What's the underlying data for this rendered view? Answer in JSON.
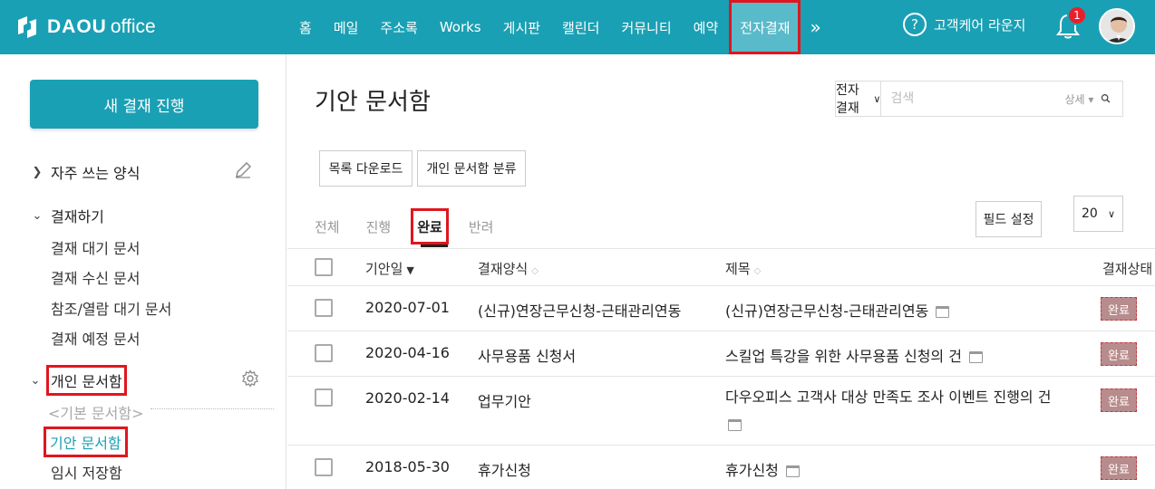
{
  "app": {
    "logo_brand": "DAOU",
    "logo_suffix": "office"
  },
  "nav": {
    "items": [
      "홈",
      "메일",
      "주소록",
      "Works",
      "게시판",
      "캘린더",
      "커뮤니티",
      "예약",
      "전자결재"
    ],
    "more": "»",
    "help_label": "고객케어 라운지",
    "notification_count": "1"
  },
  "sidebar": {
    "new_button": "새 결재 진행",
    "favorites": "자주 쓰는 양식",
    "approval_section": "결재하기",
    "approval_items": [
      "결재 대기 문서",
      "결재 수신 문서",
      "참조/열람 대기 문서",
      "결재 예정 문서"
    ],
    "personal_section": "개인 문서함",
    "default_box": "<기본 문서함>",
    "draft_box": "기안 문서함",
    "temp_box": "임시 저장함"
  },
  "main": {
    "title": "기안 문서함",
    "search": {
      "scope": "전자결재",
      "placeholder": "검색",
      "detail": "상세"
    },
    "buttons": {
      "download": "목록 다운로드",
      "classify": "개인 문서함 분류",
      "field_settings": "필드 설정",
      "page_size": "20"
    },
    "tabs": [
      "전체",
      "진행",
      "완료",
      "반려"
    ],
    "columns": [
      "기안일",
      "결재양식",
      "제목",
      "결재상태"
    ],
    "rows": [
      {
        "date": "2020-07-01",
        "form": "(신규)연장근무신청-근태관리연동",
        "title": "(신규)연장근무신청-근태관리연동",
        "status": "완료"
      },
      {
        "date": "2020-04-16",
        "form": "사무용품 신청서",
        "title": "스킬업 특강을 위한 사무용품 신청의 건",
        "status": "완료"
      },
      {
        "date": "2020-02-14",
        "form": "업무기안",
        "title": "다우오피스 고객사 대상 만족도 조사 이벤트 진행의 건",
        "status": "완료"
      },
      {
        "date": "2018-05-30",
        "form": "휴가신청",
        "title": "휴가신청",
        "status": "완료"
      }
    ]
  },
  "colors": {
    "brand": "#1aa0b4",
    "highlight": "#e0161e",
    "status_bg": "#b88c8c"
  }
}
